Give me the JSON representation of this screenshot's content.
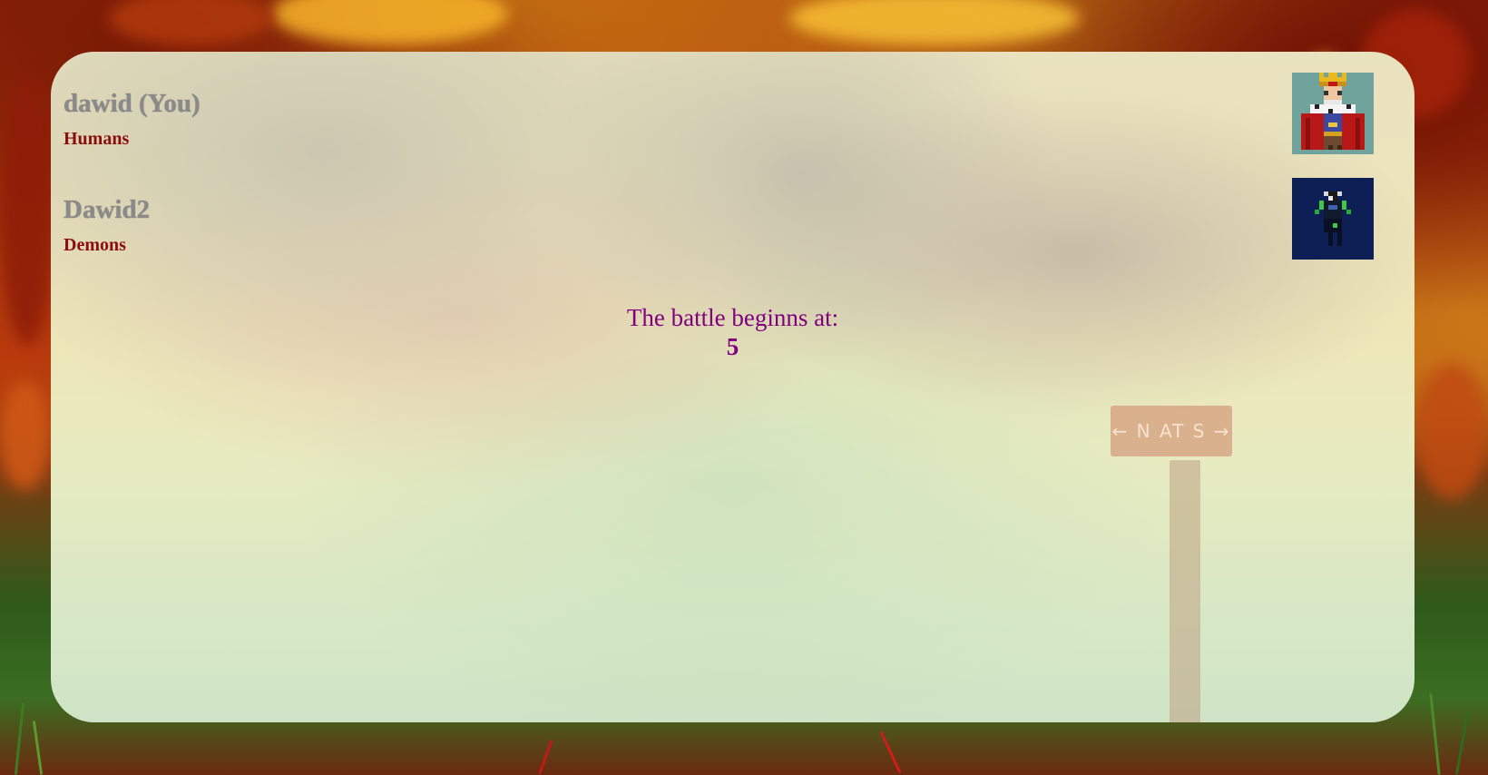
{
  "players": [
    {
      "name": "dawid (You)",
      "race": "Humans",
      "avatar_icon": "human-king-icon"
    },
    {
      "name": "Dawid2",
      "race": "Demons",
      "avatar_icon": "demon-knight-icon"
    }
  ],
  "countdown": {
    "label": "The battle beginns at:",
    "value": "5"
  },
  "sign_text": "←  N AT S →",
  "colors": {
    "race_text": "#8b0e0e",
    "countdown_text": "#800080",
    "player_name_text": "#8a8a8a",
    "demon_avatar_bg": "#0d1f55",
    "human_avatar_bg": "#6fa39b"
  }
}
